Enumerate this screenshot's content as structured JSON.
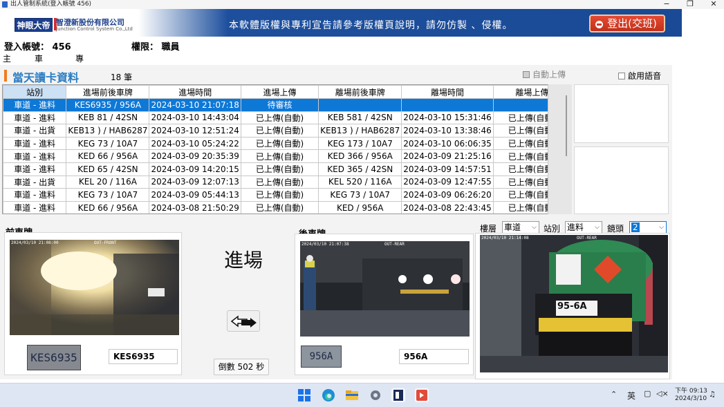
{
  "window": {
    "title": "出人管制系統(登入帳號 456)",
    "minimize_glyph": "−",
    "maximize_glyph": "❐",
    "close_glyph": "✕"
  },
  "banner": {
    "logo_text": "神眼大帝",
    "company_name": "智澄新股份有限公司",
    "company_sub": "Junction Control System Co.,Ltd",
    "notice": "本軟體版權與專利宣告請參考版權頁說明，請勿仿製 、侵權。",
    "logout_label": "登出(交班)"
  },
  "account": {
    "label": "登入帳號：",
    "value": "456",
    "perm_label": "權限：",
    "perm_value": "職員"
  },
  "menu": [
    "主頁面",
    "車牌紀錄",
    "專利與版權宣告"
  ],
  "section": {
    "title": "當天讀卡資料",
    "count": "18 筆",
    "auto_upload": "自動上傳",
    "enable_voice": "啟用語音"
  },
  "table": {
    "headers": [
      "站別",
      "進場前後車牌",
      "進場時間",
      "進場上傳",
      "離場前後車牌",
      "離場時間",
      "離場上傳"
    ],
    "rows": [
      [
        "車道 - 進料",
        "KES6935 / 956A",
        "2024-03-10 21:07:18",
        "待審核",
        "",
        "",
        ""
      ],
      [
        "車道 - 進料",
        "KEB  81 / 42SN",
        "2024-03-10 14:43:04",
        "已上傳(自動)",
        "KEB  581 / 42SN",
        "2024-03-10 15:31:46",
        "已上傳(自動)"
      ],
      [
        "車道 - 出貨",
        "KEB13 ) / HAB6287",
        "2024-03-10 12:51:24",
        "已上傳(自動)",
        "KEB13 ) / HAB6287",
        "2024-03-10 13:38:46",
        "已上傳(自動)"
      ],
      [
        "車道 - 進料",
        "KEG  73 / 10A7",
        "2024-03-10 05:24:22",
        "已上傳(自動)",
        "KEG  173 / 10A7",
        "2024-03-10 06:06:35",
        "已上傳(自動)"
      ],
      [
        "車道 - 進料",
        "KED  66 / 956A",
        "2024-03-09 20:35:39",
        "已上傳(自動)",
        "KED  366 / 956A",
        "2024-03-09 21:25:16",
        "已上傳(自動)"
      ],
      [
        "車道 - 進料",
        "KED  65 / 42SN",
        "2024-03-09 14:20:15",
        "已上傳(自動)",
        "KED  365 / 42SN",
        "2024-03-09 14:57:51",
        "已上傳(自動)"
      ],
      [
        "車道 - 出貨",
        "KEL  20 / 116A",
        "2024-03-09 12:07:13",
        "已上傳(自動)",
        "KEL  520 / 116A",
        "2024-03-09 12:47:55",
        "已上傳(自動)"
      ],
      [
        "車道 - 進料",
        "KEG  73 / 10A7",
        "2024-03-09 05:44:13",
        "已上傳(自動)",
        "KEG  73 / 10A7",
        "2024-03-09 06:26:20",
        "已上傳(自動)"
      ],
      [
        "車道 - 進料",
        "KED  66 / 956A",
        "2024-03-08 21:50:29",
        "已上傳(自動)",
        "KED  / 956A",
        "2024-03-08 22:43:45",
        "已上傳(自動)"
      ]
    ]
  },
  "front": {
    "label": "前車牌",
    "cam_ts": "2024/03/10 21:08:00",
    "cam_tag": "OUT-FRONT",
    "plate_thumb": "KES6935",
    "plate": "KES6935"
  },
  "rear": {
    "label": "後車牌",
    "cam_ts": "2024/03/10 21:07:38",
    "cam_tag": "OUT-REAR",
    "plate_thumb": "956A",
    "plate": "956A"
  },
  "direction": "進場",
  "countdown": "倒數 502 秒",
  "filters": {
    "floor_label": "樓層",
    "floor_value": "車道",
    "station_label": "站別",
    "station_value": "進料",
    "lens_label": "鏡頭",
    "lens_value": "2"
  },
  "right_cam": {
    "cam_ts": "2024/03/10 21:14:08",
    "cam_tag": "OUT-REAR",
    "truck_plate": "95-6A"
  },
  "tray": {
    "lang": "英",
    "time": "下午 09:13",
    "date": "2024/3/10"
  }
}
